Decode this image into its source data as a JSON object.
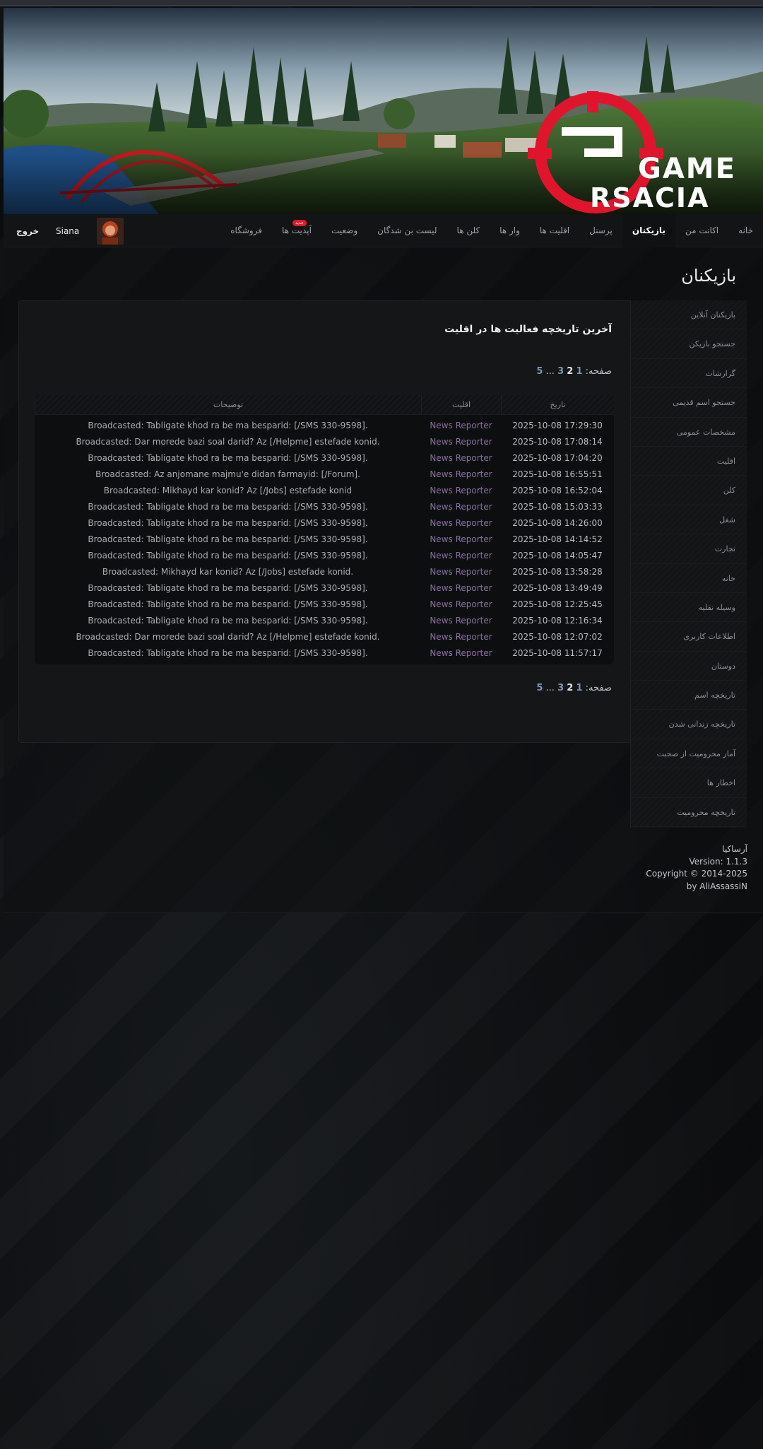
{
  "logo": {
    "line1": "GAME",
    "line2": "RSACIA",
    "mark_color": "#e0152d"
  },
  "nav": {
    "items": [
      {
        "label": "خانه",
        "active": false
      },
      {
        "label": "اکانت من",
        "active": false
      },
      {
        "label": "بازیکنان",
        "active": true
      },
      {
        "label": "پرسنل",
        "active": false
      },
      {
        "label": "اقلیت ها",
        "active": false
      },
      {
        "label": "وار ها",
        "active": false
      },
      {
        "label": "کلن ها",
        "active": false
      },
      {
        "label": "لیست بن شدگان",
        "active": false
      },
      {
        "label": "وضعیت",
        "active": false
      },
      {
        "label": "آپدیت ها",
        "active": false,
        "badge": "جدید"
      },
      {
        "label": "فروشگاه",
        "active": false
      }
    ],
    "username": "Siana",
    "logout": "خروج"
  },
  "page": {
    "title": "بازیکنان"
  },
  "panel": {
    "title": "آخرین تاریخچه فعالیت ها در اقلیت",
    "pager": {
      "label": "صفحه:",
      "pages": [
        "1",
        "2",
        "3",
        "...",
        "5"
      ],
      "current": "2"
    }
  },
  "table": {
    "headers": {
      "date": "تاریخ",
      "faction": "اقلیت",
      "description": "توضیحات"
    },
    "rows": [
      {
        "date": "2025-10-08 17:29:30",
        "faction": "News Reporter",
        "description": "Broadcasted: Tabligate khod ra be ma besparid: [/SMS 330-9598]."
      },
      {
        "date": "2025-10-08 17:08:14",
        "faction": "News Reporter",
        "description": "Broadcasted: Dar morede bazi soal darid? Az [/Helpme] estefade konid."
      },
      {
        "date": "2025-10-08 17:04:20",
        "faction": "News Reporter",
        "description": "Broadcasted: Tabligate khod ra be ma besparid: [/SMS 330-9598]."
      },
      {
        "date": "2025-10-08 16:55:51",
        "faction": "News Reporter",
        "description": "Broadcasted: Az anjomane majmu'e didan farmayid: [/Forum]."
      },
      {
        "date": "2025-10-08 16:52:04",
        "faction": "News Reporter",
        "description": "Broadcasted: Mikhayd kar konid? Az [/Jobs] estefade konid"
      },
      {
        "date": "2025-10-08 15:03:33",
        "faction": "News Reporter",
        "description": "Broadcasted: Tabligate khod ra be ma besparid: [/SMS 330-9598]."
      },
      {
        "date": "2025-10-08 14:26:00",
        "faction": "News Reporter",
        "description": "Broadcasted: Tabligate khod ra be ma besparid: [/SMS 330-9598]."
      },
      {
        "date": "2025-10-08 14:14:52",
        "faction": "News Reporter",
        "description": "Broadcasted: Tabligate khod ra be ma besparid: [/SMS 330-9598]."
      },
      {
        "date": "2025-10-08 14:05:47",
        "faction": "News Reporter",
        "description": "Broadcasted: Tabligate khod ra be ma besparid: [/SMS 330-9598]."
      },
      {
        "date": "2025-10-08 13:58:28",
        "faction": "News Reporter",
        "description": "Broadcasted: Mikhayd kar konid? Az [/Jobs] estefade konid."
      },
      {
        "date": "2025-10-08 13:49:49",
        "faction": "News Reporter",
        "description": "Broadcasted: Tabligate khod ra be ma besparid: [/SMS 330-9598]."
      },
      {
        "date": "2025-10-08 12:25:45",
        "faction": "News Reporter",
        "description": "Broadcasted: Tabligate khod ra be ma besparid: [/SMS 330-9598]."
      },
      {
        "date": "2025-10-08 12:16:34",
        "faction": "News Reporter",
        "description": "Broadcasted: Tabligate khod ra be ma besparid: [/SMS 330-9598]."
      },
      {
        "date": "2025-10-08 12:07:02",
        "faction": "News Reporter",
        "description": "Broadcasted: Dar morede bazi soal darid? Az [/Helpme] estefade konid."
      },
      {
        "date": "2025-10-08 11:57:17",
        "faction": "News Reporter",
        "description": "Broadcasted: Tabligate khod ra be ma besparid: [/SMS 330-9598]."
      }
    ]
  },
  "sidebar": {
    "items": [
      "بازیکنان آنلاین",
      "جستجو بازیکن",
      "گزارشات",
      "جستجو اسم قدیمی",
      "مشخصات عمومی",
      "اقلیت",
      "کلن",
      "شغل",
      "تجارت",
      "خانه",
      "وسیله نقلیه",
      "اطلاعات کاربری",
      "دوستان",
      "تاریخچه اسم",
      "تاریخچه زندانی شدن",
      "آمار محرومیت از صحبت",
      "اخطار ها",
      "تاریخچه محرومیت"
    ]
  },
  "footer": {
    "site_name": "آرساکیا",
    "version": "Version: 1.1.3",
    "copyright": "Copyright © 2014-2025",
    "author": "by AliAssassiN"
  },
  "colors": {
    "accent_red": "#e0152d",
    "faction_link": "#8a6ea0",
    "pager_link": "#7c95b8"
  }
}
